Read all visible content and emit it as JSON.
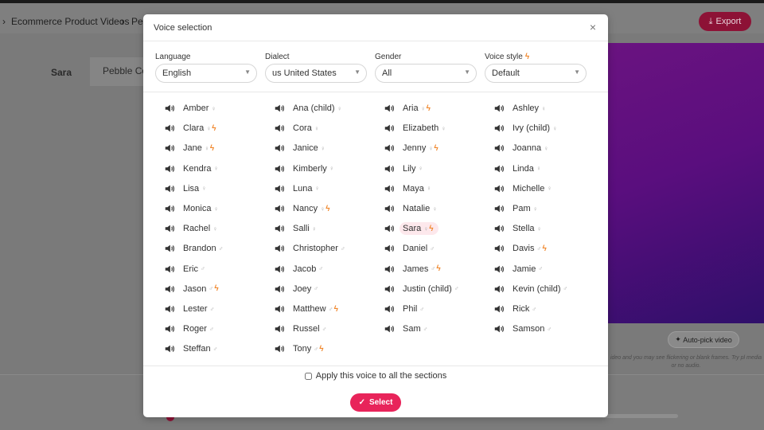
{
  "background": {
    "breadcrumbs": [
      "Ecommerce Product Videos",
      "Pel"
    ],
    "export_label": "Export",
    "tabs": [
      "Sara",
      "Pebble Co"
    ],
    "auto_pick_label": "Auto-pick video",
    "note": "ideo and you may see flickering or blank frames. Try pl media or no audio."
  },
  "modal": {
    "title": "Voice selection",
    "close_icon": "×",
    "filters": {
      "language": {
        "label": "Language",
        "value": "English"
      },
      "dialect": {
        "label": "Dialect",
        "value": "us United States"
      },
      "gender": {
        "label": "Gender",
        "value": "All"
      },
      "voice_style": {
        "label": "Voice style",
        "value": "Default"
      }
    },
    "voices": [
      [
        {
          "name": "Amber",
          "g": "♀"
        },
        {
          "name": "Clara",
          "g": "♀",
          "bolt": true
        },
        {
          "name": "Jane",
          "g": "♀",
          "bolt": true
        },
        {
          "name": "Kendra",
          "g": "♀"
        },
        {
          "name": "Lisa",
          "g": "♀"
        },
        {
          "name": "Monica",
          "g": "♀"
        },
        {
          "name": "Rachel",
          "g": "♀"
        },
        {
          "name": "Brandon",
          "g": "♂"
        },
        {
          "name": "Eric",
          "g": "♂"
        },
        {
          "name": "Jason",
          "g": "♂",
          "bolt": true
        },
        {
          "name": "Lester",
          "g": "♂"
        },
        {
          "name": "Roger",
          "g": "♂"
        },
        {
          "name": "Steffan",
          "g": "♂"
        }
      ],
      [
        {
          "name": "Ana (child)",
          "g": "♀"
        },
        {
          "name": "Cora",
          "g": "♀"
        },
        {
          "name": "Janice",
          "g": "♀"
        },
        {
          "name": "Kimberly",
          "g": "♀"
        },
        {
          "name": "Luna",
          "g": "♀"
        },
        {
          "name": "Nancy",
          "g": "♀",
          "bolt": true
        },
        {
          "name": "Salli",
          "g": "♀"
        },
        {
          "name": "Christopher",
          "g": "♂"
        },
        {
          "name": "Jacob",
          "g": "♂"
        },
        {
          "name": "Joey",
          "g": "♂"
        },
        {
          "name": "Matthew",
          "g": "♂",
          "bolt": true
        },
        {
          "name": "Russel",
          "g": "♂"
        },
        {
          "name": "Tony",
          "g": "♂",
          "bolt": true
        }
      ],
      [
        {
          "name": "Aria",
          "g": "♀",
          "bolt": true
        },
        {
          "name": "Elizabeth",
          "g": "♀"
        },
        {
          "name": "Jenny",
          "g": "♀",
          "bolt": true
        },
        {
          "name": "Lily",
          "g": "♀"
        },
        {
          "name": "Maya",
          "g": "♀"
        },
        {
          "name": "Natalie",
          "g": "♀"
        },
        {
          "name": "Sara",
          "g": "♀",
          "bolt": true,
          "selected": true
        },
        {
          "name": "Daniel",
          "g": "♂"
        },
        {
          "name": "James",
          "g": "♂",
          "bolt": true
        },
        {
          "name": "Justin (child)",
          "g": "♂"
        },
        {
          "name": "Phil",
          "g": "♂"
        },
        {
          "name": "Sam",
          "g": "♂"
        }
      ],
      [
        {
          "name": "Ashley",
          "g": "♀"
        },
        {
          "name": "Ivy (child)",
          "g": "♀"
        },
        {
          "name": "Joanna",
          "g": "♀"
        },
        {
          "name": "Linda",
          "g": "♀"
        },
        {
          "name": "Michelle",
          "g": "♀"
        },
        {
          "name": "Pam",
          "g": "♀"
        },
        {
          "name": "Stella",
          "g": "♀"
        },
        {
          "name": "Davis",
          "g": "♂",
          "bolt": true
        },
        {
          "name": "Jamie",
          "g": "♂"
        },
        {
          "name": "Kevin (child)",
          "g": "♂"
        },
        {
          "name": "Rick",
          "g": "♂"
        },
        {
          "name": "Samson",
          "g": "♂"
        }
      ]
    ],
    "apply_label": "Apply this voice to all the sections",
    "apply_checked": false,
    "select_label": "Select"
  },
  "colors": {
    "accent": "#e8245a",
    "bolt": "#f0862a",
    "selected_bg": "#fde8ec"
  }
}
